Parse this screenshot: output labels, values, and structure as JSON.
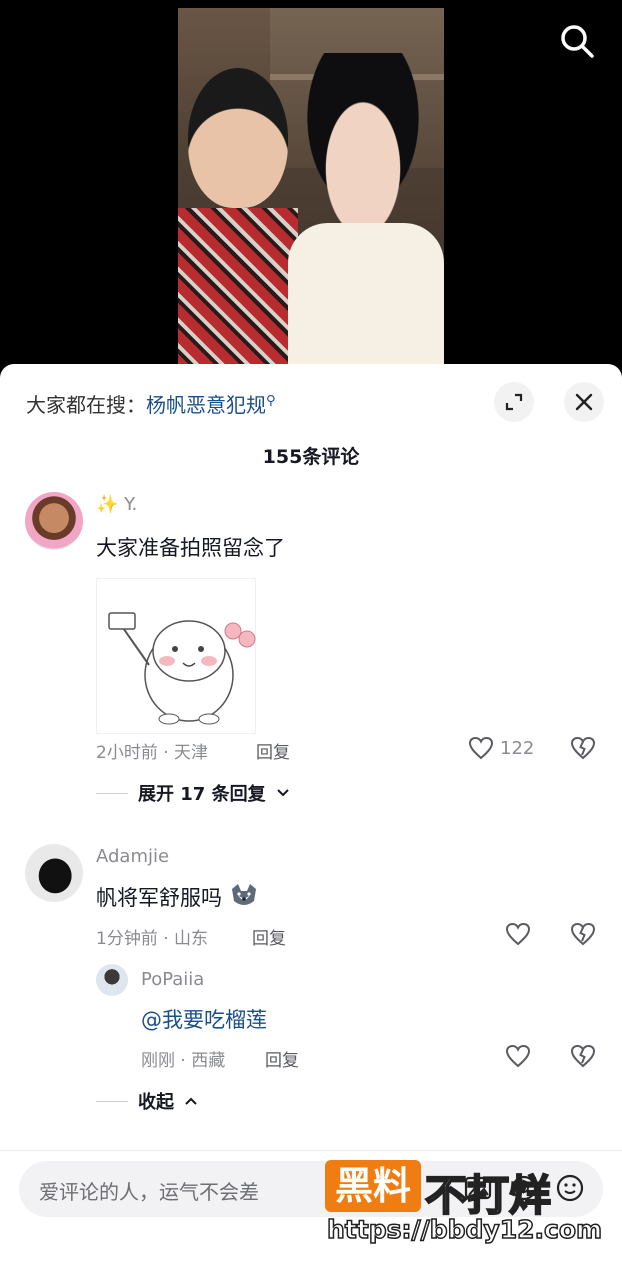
{
  "trending": {
    "prefix": "大家都在搜：",
    "term": "杨帆恶意犯规"
  },
  "comments_title": "155条评论",
  "comments": [
    {
      "username": "✨ Y.",
      "text": "大家准备拍照留念了",
      "time_location": "2小时前 · 天津",
      "reply_label": "回复",
      "likes": "122",
      "expand_label": "展开 17 条回复"
    },
    {
      "username": "Adamjie",
      "text": "帆将军舒服吗",
      "time_location": "1分钟前 · 山东",
      "reply_label": "回复",
      "reply": {
        "username": "PoPaiia",
        "text": "@我要吃榴莲",
        "time_location": "刚刚 · 西藏",
        "reply_label": "回复"
      },
      "collapse_label": "收起"
    }
  ],
  "input": {
    "placeholder": "爱评论的人，运气不会差"
  },
  "watermark": {
    "badge": "黑料",
    "text": "不打烊",
    "url": "https://bbdy12.com"
  },
  "icons": {
    "search": "search-icon",
    "expand": "expand-icon",
    "close": "close-icon",
    "like": "heart-icon",
    "dislike": "broken-heart-icon"
  },
  "colors": {
    "highlight": "#1b4f8a",
    "watermark_orange": "#f07d12"
  }
}
